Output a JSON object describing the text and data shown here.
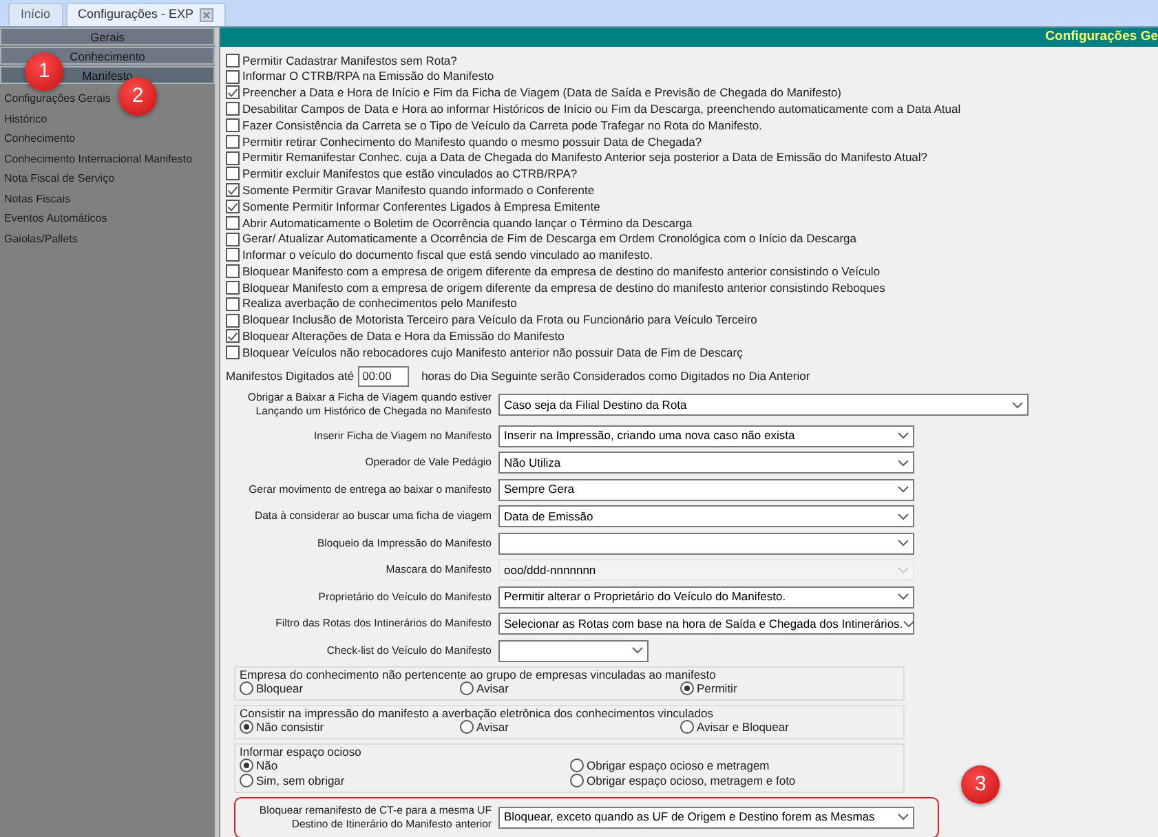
{
  "tabs": [
    {
      "label": "Início",
      "selected": false,
      "closable": false
    },
    {
      "label": "Configurações - EXP",
      "selected": true,
      "closable": true
    }
  ],
  "sidebar": {
    "sections": [
      {
        "label": "Gerais",
        "selected": false
      },
      {
        "label": "Conhecimento",
        "selected": false
      },
      {
        "label": "Manifesto",
        "selected": true
      }
    ],
    "items": [
      "Configurações Gerais",
      "Histórico",
      "Conhecimento",
      "Conhecimento Internacional Manifesto",
      "Nota Fiscal de Serviço",
      "Notas Fiscais",
      "Eventos Automáticos",
      "Gaiolas/Pallets"
    ]
  },
  "header": {
    "title": "Configurações Ge"
  },
  "checkboxes": [
    {
      "label": "Permitir Cadastrar Manifestos sem Rota?",
      "checked": false
    },
    {
      "label": "Informar O CTRB/RPA na Emissão do Manifesto",
      "checked": false
    },
    {
      "label": "Preencher a Data e Hora de Início e Fim da Ficha de Viagem (Data de Saída e Previsão de Chegada do Manifesto)",
      "checked": true
    },
    {
      "label": "Desabilitar Campos de Data e Hora ao informar Históricos de Início ou Fim da Descarga, preenchendo automaticamente com a Data Atual",
      "checked": false
    },
    {
      "label": "Fazer Consistência da Carreta  se o Tipo de Veículo da Carreta pode Trafegar no Rota do Manifesto.",
      "checked": false
    },
    {
      "label": "Permitir retirar Conhecimento do Manifesto quando o mesmo possuir Data de Chegada?",
      "checked": false
    },
    {
      "label": "Permitir Remanifestar Conhec. cuja a Data de Chegada do Manifesto Anterior seja posterior a Data de Emissão do Manifesto Atual?",
      "checked": false
    },
    {
      "label": "Permitir excluir Manifestos que estão vinculados ao CTRB/RPA?",
      "checked": false
    },
    {
      "label": "Somente Permitir Gravar Manifesto quando informado o Conferente",
      "checked": true
    },
    {
      "label": "Somente Permitir Informar Conferentes Ligados à Empresa Emitente",
      "checked": true
    },
    {
      "label": "Abrir Automaticamente o Boletim de Ocorrência quando lançar o Término da Descarga",
      "checked": false
    },
    {
      "label": "Gerar/ Atualizar Automaticamente a Ocorrência de Fim de Descarga em Ordem Cronológica com o Início da Descarga",
      "checked": false
    },
    {
      "label": "Informar o veículo do documento fiscal que está sendo vinculado ao manifesto.",
      "checked": false
    },
    {
      "label": "Bloquear Manifesto com a empresa de origem diferente da empresa de destino do manifesto anterior consistindo o Veículo",
      "checked": false
    },
    {
      "label": "Bloquear Manifesto com a empresa de origem diferente da empresa de destino do manifesto anterior consistindo Reboques",
      "checked": false
    },
    {
      "label": "Realiza averbação de conhecimentos pelo Manifesto",
      "checked": false
    },
    {
      "label": "Bloquear Inclusão de Motorista Terceiro para Veículo da Frota ou Funcionário para Veículo Terceiro",
      "checked": false
    },
    {
      "label": "Bloquear Alterações de Data e Hora da Emissão do Manifesto",
      "checked": true
    },
    {
      "label": "Bloquear Veículos não rebocadores cujo Manifesto anterior não possuir Data de Fim de Descarç",
      "checked": false
    }
  ],
  "hours": {
    "label": "Manifestos Digitados até",
    "value": "00:00",
    "suffix": "horas do Dia Seguinte serão Considerados como Digitados no Dia Anterior"
  },
  "dropdowns": [
    {
      "label": "Obrigar a Baixar a Ficha de Viagem quando estiver Lançando um Histórico de Chegada no Manifesto",
      "value": "Caso seja da Filial Destino da Rota",
      "disabled": false
    },
    {
      "label": "Inserir Ficha de Viagem no Manifesto",
      "value": "Inserir na Impressão, criando uma nova caso não exista",
      "disabled": false
    },
    {
      "label": "Operador de Vale Pedágio",
      "value": "Não Utiliza",
      "disabled": false
    },
    {
      "label": "Gerar movimento de entrega ao baixar o manifesto",
      "value": "Sempre Gera",
      "disabled": false
    },
    {
      "label": "Data à considerar ao buscar uma ficha de viagem",
      "value": "Data de Emissão",
      "disabled": false
    },
    {
      "label": "Bloqueio da Impressão do Manifesto",
      "disabled": false
    },
    {
      "label": "Mascara do Manifesto",
      "value": "ooo/ddd-nnnnnnn",
      "disabled": true
    },
    {
      "label": "Proprietário do Veículo do Manifesto",
      "value": "Permitir alterar o Proprietário do Veículo do Manifesto.",
      "disabled": false
    },
    {
      "label": "Filtro das Rotas dos Intinerários do Manifesto",
      "value": "Selecionar as Rotas com base na hora de Saída e Chegada dos Intinerários.",
      "disabled": false
    },
    {
      "label": "Check-list do Veículo do Manifesto",
      "disabled": false
    }
  ],
  "radio_groups": [
    {
      "title": "Empresa do conhecimento não pertencente ao grupo de empresas vinculadas ao manifesto",
      "options": [
        {
          "label": "Bloquear",
          "selected": false
        },
        {
          "label": "Avisar",
          "selected": false
        },
        {
          "label": "Permitir",
          "selected": true
        }
      ]
    },
    {
      "title": "Consistir na impressão do manifesto a averbação eletrônica dos conhecimentos vinculados",
      "options": [
        {
          "label": "Não consistir",
          "selected": true
        },
        {
          "label": "Avisar",
          "selected": false
        },
        {
          "label": "Avisar e Bloquear",
          "selected": false
        }
      ]
    },
    {
      "title": "Informar espaço ocioso",
      "options": [
        {
          "label": "Não",
          "selected": true
        },
        {
          "label": "Sim, sem obrigar",
          "selected": false
        },
        {
          "label": "Obrigar espaço ocioso e metragem",
          "selected": false
        },
        {
          "label": "Obrigar espaço ocioso, metragem e foto",
          "selected": false
        }
      ]
    }
  ],
  "remanifest": {
    "label_lines": [
      "Bloquear remanifesto de CT-e para a mesma UF",
      "Destino de Itinerário do Manifesto anterior"
    ],
    "value": "Bloquear, exceto quando as UF de Origem e Destino forem as Mesmas",
    "highlighted": true
  },
  "annotations": [
    "1",
    "2",
    "3"
  ]
}
